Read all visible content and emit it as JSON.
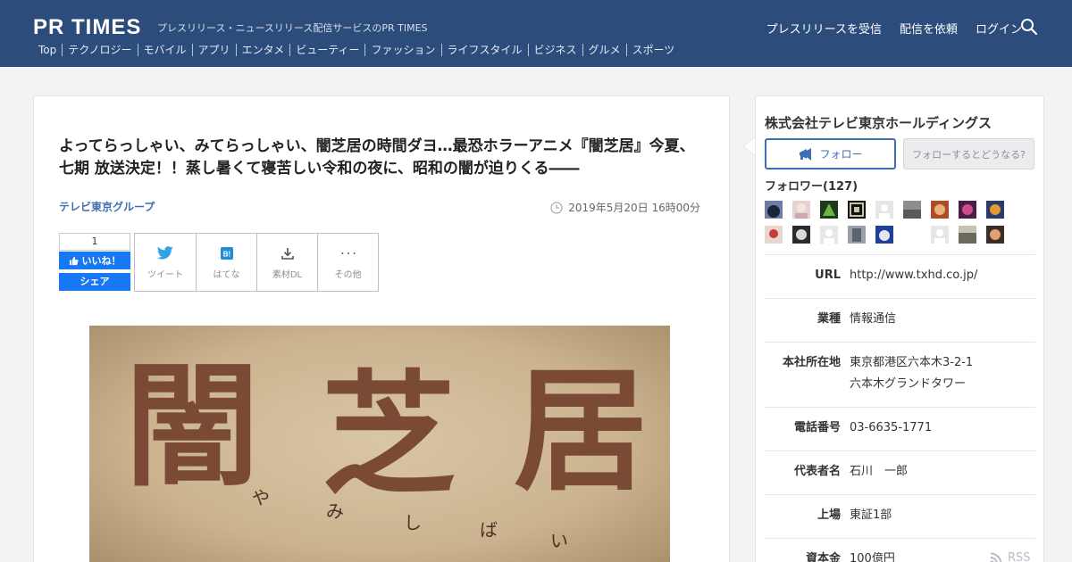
{
  "header": {
    "logo": "PR TIMES",
    "tagline": "プレスリリース・ニュースリリース配信サービスのPR TIMES",
    "links": [
      "プレスリリースを受信",
      "配信を依頼",
      "ログイン"
    ],
    "categories": [
      "Top",
      "テクノロジー",
      "モバイル",
      "アプリ",
      "エンタメ",
      "ビューティー",
      "ファッション",
      "ライフスタイル",
      "ビジネス",
      "グルメ",
      "スポーツ"
    ]
  },
  "article": {
    "title": "よってらっしゃい、みてらっしゃい、闇芝居の時間ダヨ…最恐ホラーアニメ『闇芝居』今夏、七期 放送決定！！蒸し暑くて寝苦しい令和の夜に、昭和の闇が迫りくる――",
    "company": "テレビ東京グループ",
    "date": "2019年5月20日 16時00分",
    "facebook": {
      "count": "1",
      "like_label": "いいね！",
      "share_label": "シェア"
    },
    "share_buttons": [
      "ツイート",
      "はてな",
      "素材DL",
      "その他"
    ],
    "hero": {
      "kanji": [
        "闇",
        "芝",
        "居"
      ],
      "kana": [
        "や",
        "み",
        "し",
        "ば",
        "い"
      ]
    }
  },
  "sidebar": {
    "company_name": "株式会社テレビ東京ホールディングス",
    "follow_label": "フォロー",
    "follow_what_label": "フォローするとどうなる?",
    "followers_label": "フォロワー(127)",
    "info": [
      {
        "key": "URL",
        "value": [
          "http://www.txhd.co.jp/"
        ]
      },
      {
        "key": "業種",
        "value": [
          "情報通信"
        ]
      },
      {
        "key": "本社所在地",
        "value": [
          "東京都港区六本木3-2-1",
          "六本木グランドタワー"
        ]
      },
      {
        "key": "電話番号",
        "value": [
          "03-6635-1771"
        ]
      },
      {
        "key": "代表者名",
        "value": [
          "石川　一郎"
        ]
      },
      {
        "key": "上場",
        "value": [
          "東証1部"
        ]
      },
      {
        "key": "資本金",
        "value": [
          "100億円"
        ]
      }
    ],
    "rss_label": "RSS"
  }
}
